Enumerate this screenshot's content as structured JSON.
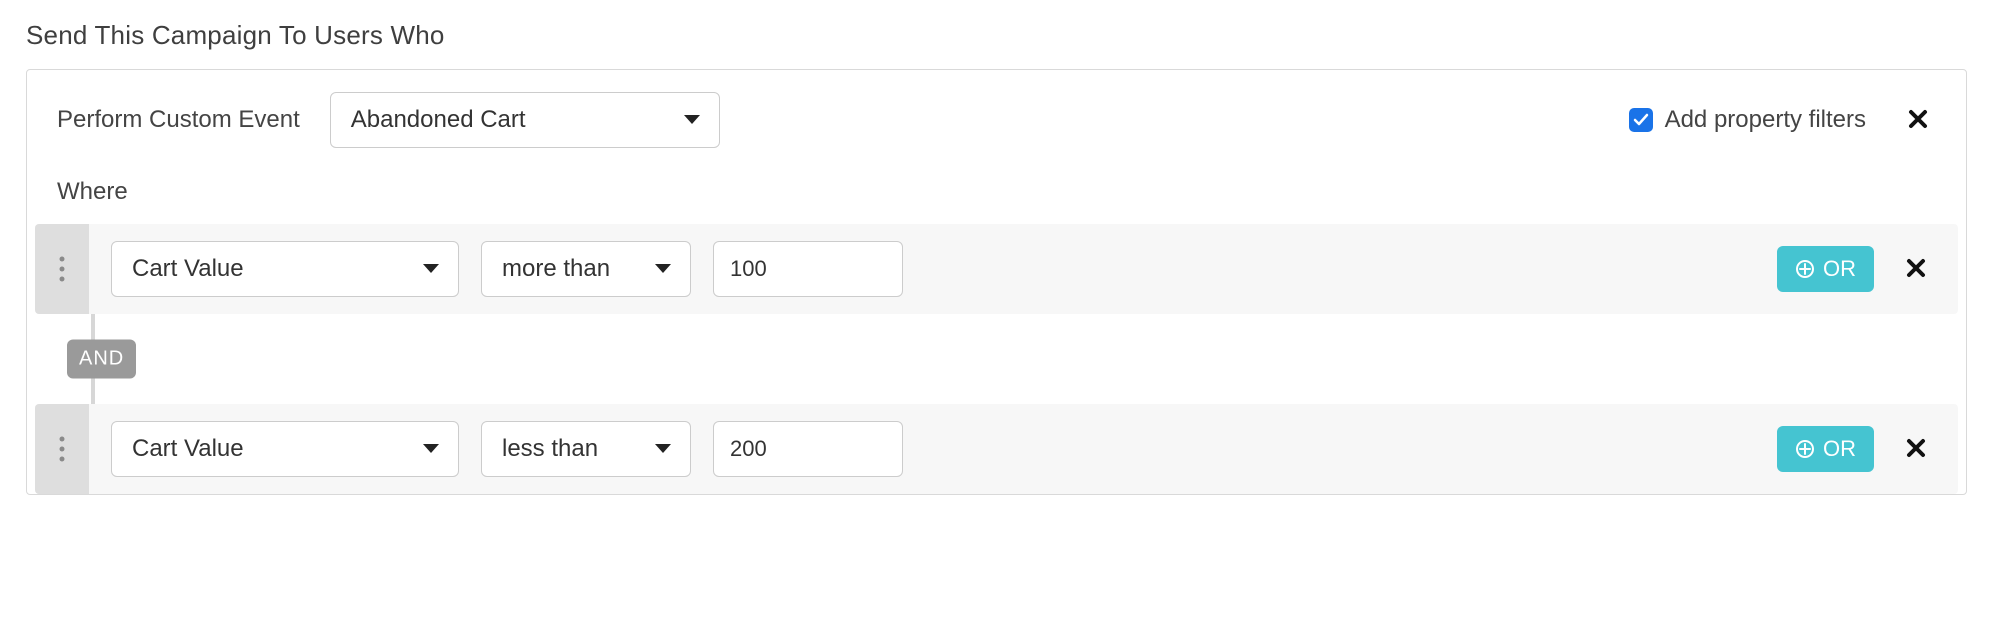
{
  "heading": "Send This Campaign To Users Who",
  "event": {
    "label": "Perform Custom Event",
    "selected": "Abandoned Cart"
  },
  "property_filters": {
    "checkbox_checked": true,
    "label": "Add property filters"
  },
  "where_label": "Where",
  "and_label": "AND",
  "or_label": "OR",
  "filters": [
    {
      "property": "Cart Value",
      "operator": "more than",
      "value": "100"
    },
    {
      "property": "Cart Value",
      "operator": "less than",
      "value": "200"
    }
  ]
}
